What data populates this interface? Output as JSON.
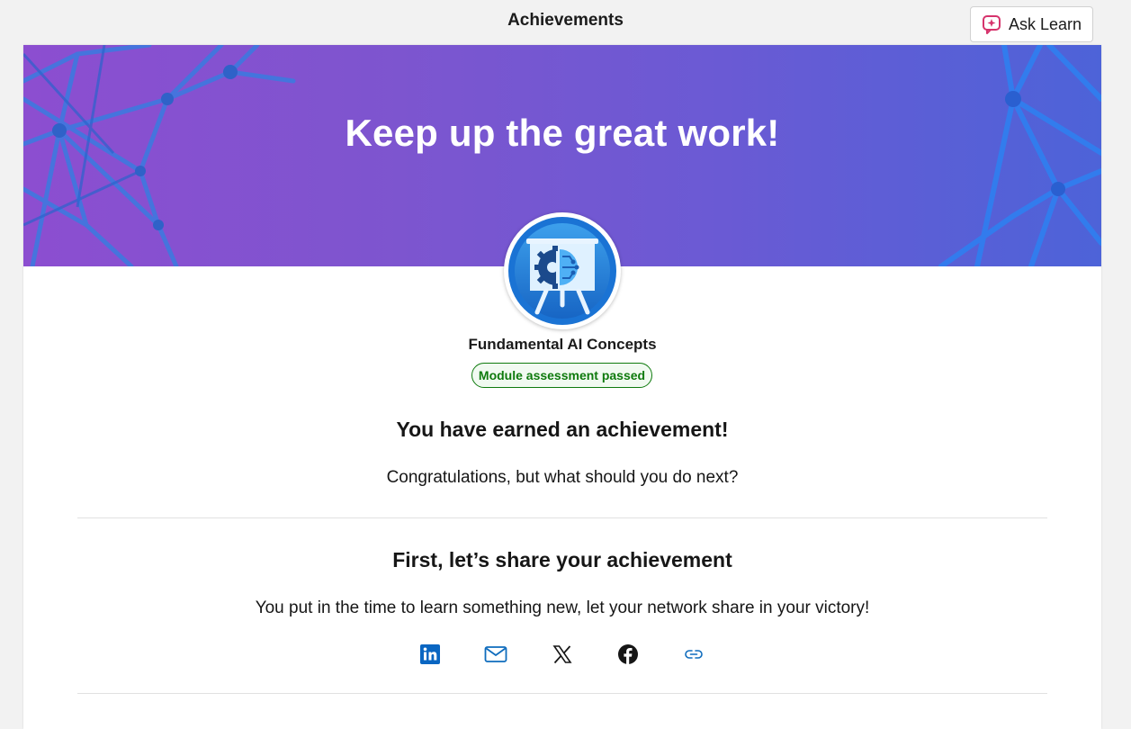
{
  "header": {
    "title": "Achievements",
    "ask_learn_label": "Ask Learn",
    "ask_learn_icon": "sparkle-chat-icon"
  },
  "banner": {
    "title": "Keep up the great work!"
  },
  "achievement": {
    "badge_icon": "ai-concepts-badge-icon",
    "module_name": "Fundamental AI Concepts",
    "status": "Module assessment passed",
    "earned_heading": "You have earned an achievement!",
    "earned_text": "Congratulations, but what should you do next?"
  },
  "share": {
    "heading": "First, let’s share your achievement",
    "text": "You put in the time to learn something new, let your network share in your victory!",
    "buttons": [
      {
        "icon": "linkedin-icon"
      },
      {
        "icon": "email-icon"
      },
      {
        "icon": "x-icon"
      },
      {
        "icon": "facebook-icon"
      },
      {
        "icon": "link-icon"
      }
    ]
  },
  "colors": {
    "accent_blue": "#0f6cbd",
    "status_green": "#0e7a0d",
    "banner_start": "#8c4ed0",
    "banner_end": "#4d63d8"
  }
}
